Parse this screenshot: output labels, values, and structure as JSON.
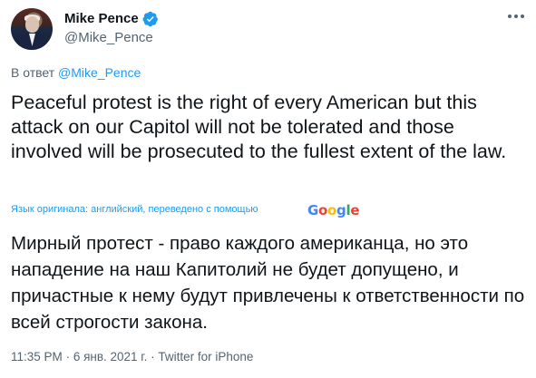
{
  "author": {
    "name": "Mike Pence",
    "handle": "@Mike_Pence",
    "verified": true,
    "verified_icon": "verified-badge-icon"
  },
  "more_icon": "more-dots-icon",
  "reply": {
    "prefix": "В ответ",
    "mention": "@Mike_Pence"
  },
  "tweet": {
    "original_text": "Peaceful protest is the right of every American but this attack on our Capitol will not be tolerated and those involved will be prosecuted to the fullest extent of the law.",
    "translation_note": "Язык оригинала: английский, переведено с помощью",
    "translation_provider": "Google",
    "translated_text": "Мирный протест - право каждого американца, но это нападение на наш Капитолий не будет допущено, и причастные к нему будут привлечены к ответственности по всей строгости закона."
  },
  "meta": {
    "time": "11:35 PM",
    "separator": "·",
    "date": "6 янв. 2021 г.",
    "source": "Twitter for iPhone"
  },
  "colors": {
    "accent": "#1d9bf0",
    "text": "#0f1419",
    "secondary": "#536471",
    "google_blue": "#4285f4",
    "google_red": "#ea4335",
    "google_yellow": "#fbbc05",
    "google_green": "#34a853"
  }
}
